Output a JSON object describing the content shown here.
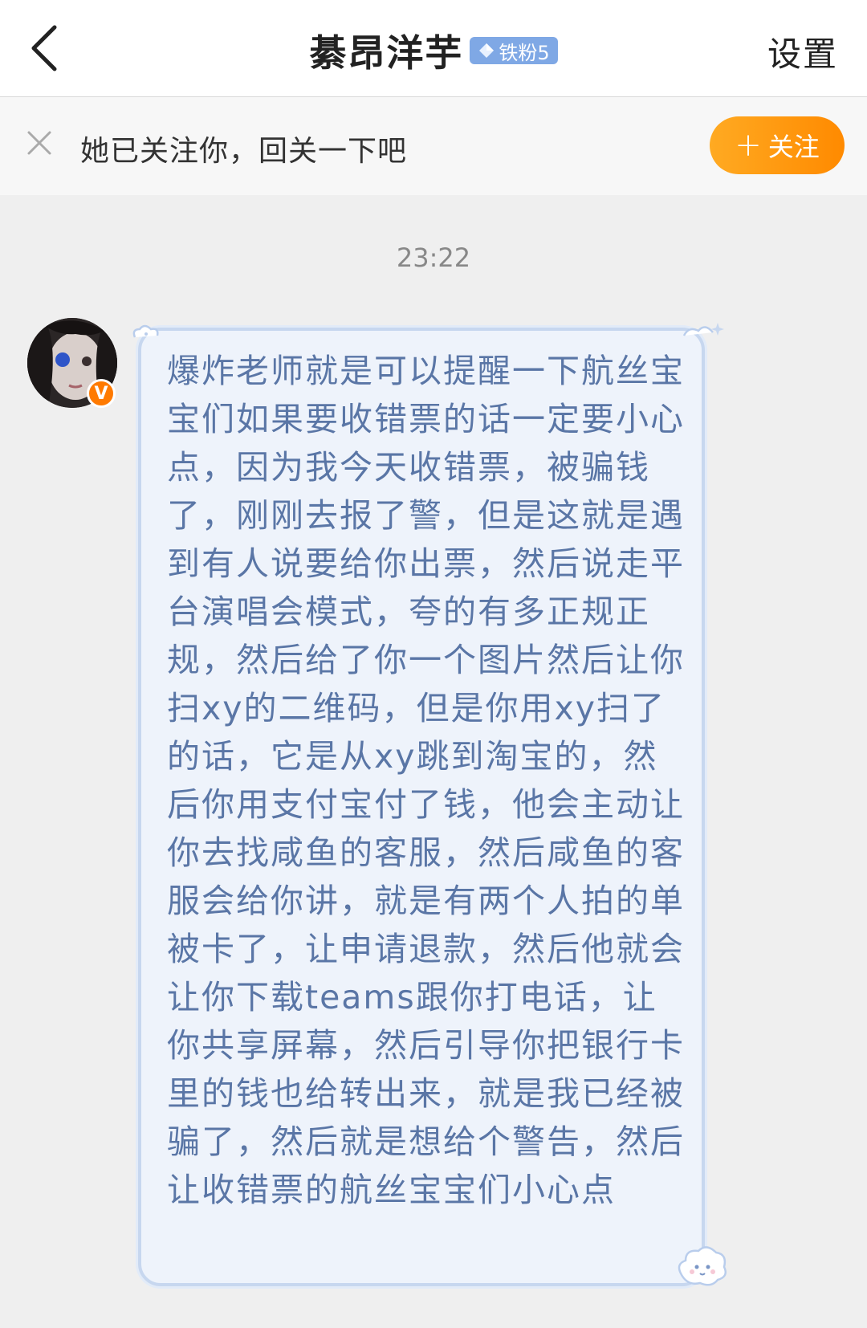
{
  "header": {
    "title": "綦昂洋芋",
    "badge_label": "铁粉5",
    "settings_label": "设置"
  },
  "follow_bar": {
    "prompt": "她已关注你，回关一下吧",
    "button_label": "关注"
  },
  "chat": {
    "timestamp": "23:22",
    "avatar_badge": "V",
    "message": "爆炸老师就是可以提醒一下航丝宝宝们如果要收错票的话一定要小心点，因为我今天收错票，被骗钱了，刚刚去报了警，但是这就是遇到有人说要给你出票，然后说走平台演唱会模式，夸的有多正规正规，然后给了你一个图片然后让你扫xy的二维码，但是你用xy扫了的话，它是从xy跳到淘宝的，然后你用支付宝付了钱，他会主动让你去找咸鱼的客服，然后咸鱼的客服会给你讲，就是有两个人拍的单被卡了，让申请退款，然后他就会让你下载teams跟你打电话，让你共享屏幕，然后引导你把银行卡里的钱也给转出来，就是我已经被骗了，然后就是想给个警告，然后让收错票的航丝宝宝们小心点"
  },
  "colors": {
    "accent_orange": "#ff8a00",
    "bubble_bg": "#eef3fb",
    "bubble_text": "#5a76a6",
    "badge_blue": "#7fa8e5"
  }
}
